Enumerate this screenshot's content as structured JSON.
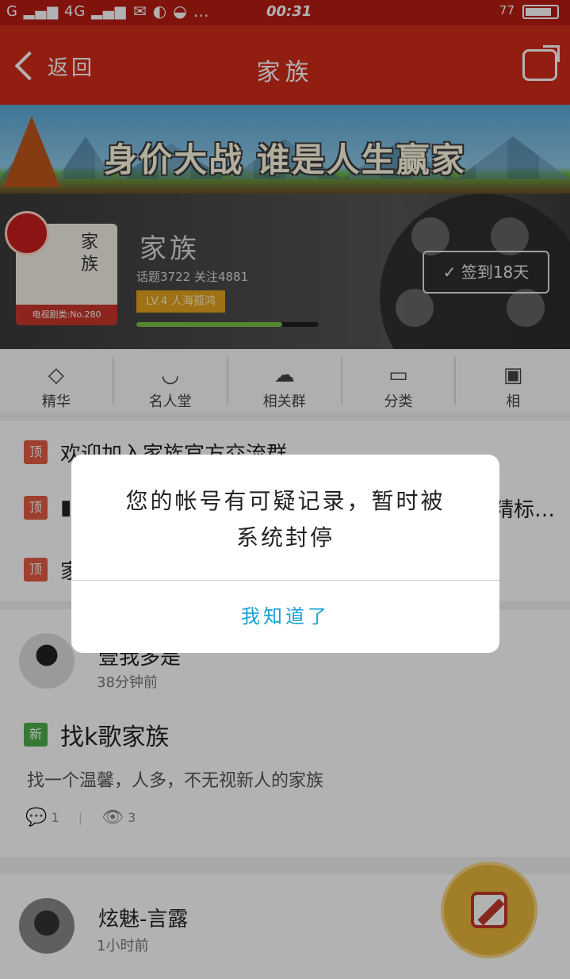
{
  "status_bar": {
    "signal_text": "G",
    "network": "4G",
    "time": "00:31",
    "battery": "77"
  },
  "navbar": {
    "back_label": "返回",
    "title": "家族"
  },
  "banner": {
    "text": "身价大战  谁是人生赢家"
  },
  "family": {
    "cover_text": "家族",
    "category_badge": "电视剧类:No.280",
    "name": "家族",
    "stats": "话题3722  关注4881",
    "level": "LV.4  人海孤鸿",
    "progress": 0.8,
    "checkin_label": "签到18天"
  },
  "tabs": [
    {
      "icon": "◇",
      "label": "精华"
    },
    {
      "icon": "◡",
      "label": "名人堂"
    },
    {
      "icon": "☁",
      "label": "相关群"
    },
    {
      "icon": "▭",
      "label": "分类"
    },
    {
      "icon": "▣",
      "label": "相"
    }
  ],
  "pinned": [
    {
      "tag": "顶",
      "text": "欢迎加入家族官方交流群"
    },
    {
      "tag": "顶",
      "text": "▮",
      "tail": "精标…"
    },
    {
      "tag": "顶",
      "text": "家"
    }
  ],
  "posts": [
    {
      "user": "壹我多是",
      "time": "38分钟前",
      "tag": "新",
      "title": "找k歌家族",
      "desc": "找一个温馨，人多，不无视新人的家族",
      "comments": "1",
      "views": "3"
    },
    {
      "user": "炫魅-言露",
      "time": "1小时前"
    }
  ],
  "dialog": {
    "message_line1": "您的帐号有可疑记录，暂时被",
    "message_line2": "系统封停",
    "confirm_label": "我知道了"
  }
}
